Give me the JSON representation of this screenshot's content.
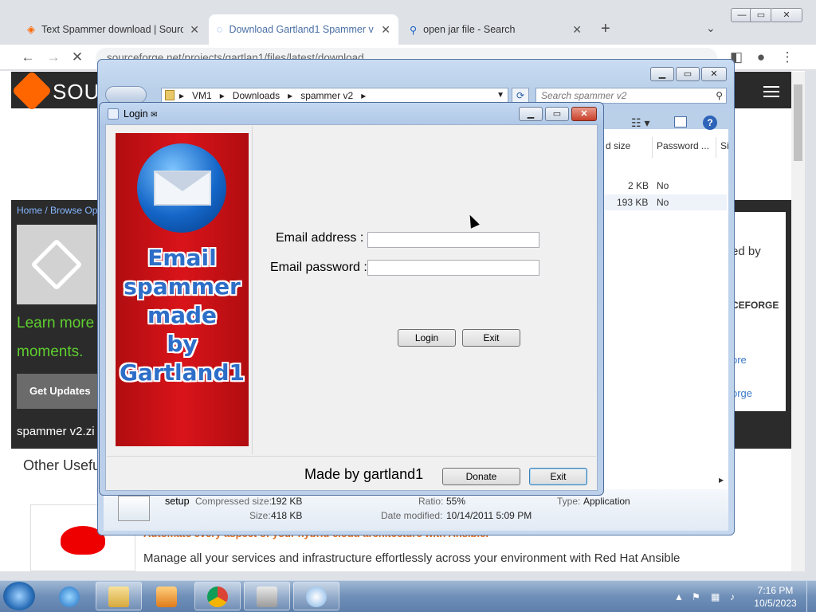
{
  "browser": {
    "tabs": [
      {
        "title": "Text Spammer download | Sourc",
        "active": false
      },
      {
        "title": "Download Gartland1 Spammer v",
        "active": true
      },
      {
        "title": "open jar file - Search",
        "active": false
      }
    ],
    "new_tab": "+",
    "url": "sourceforge.net/projects/gartlan1/files/latest/download"
  },
  "webpage": {
    "logo_text": "SOUR",
    "breadcrumb": "Home / Browse Ope",
    "green_line1": "Learn more",
    "green_line2": "moments.",
    "get_updates": "Get Updates",
    "zip_name": "spammer v2.zi",
    "right_sponsored": "ed by",
    "right_brand": "CEFORGE",
    "right_link1": "ore",
    "right_link2": "orge",
    "other_useful": "Other Usefu",
    "rh_orange": "Automate every aspect of your hybrid cloud architecture with Ansible.",
    "rh_desc": "Manage all your services and infrastructure effortlessly across your environment with Red Hat Ansible"
  },
  "explorer": {
    "path": [
      "VM1",
      "Downloads",
      "spammer v2"
    ],
    "search_placeholder": "Search spammer v2",
    "columns": [
      "d size",
      "Password ...",
      "Si"
    ],
    "rows": [
      {
        "size": "2 KB",
        "password": "No"
      },
      {
        "size": "193 KB",
        "password": "No"
      }
    ],
    "details": {
      "name": "setup",
      "compressed_label": "Compressed size:",
      "compressed": "192 KB",
      "size_label": "Size:",
      "size": "418 KB",
      "ratio_label": "Ratio:",
      "ratio": "55%",
      "date_label": "Date modified:",
      "date": "10/14/2011 5:09 PM",
      "type_label": "Type:",
      "type": "Application"
    }
  },
  "login": {
    "title": "Login",
    "banner_lines": [
      "Email",
      "spammer",
      "made",
      "by",
      "Gartland1"
    ],
    "email_label": "Email address :",
    "password_label": "Email password :",
    "login_btn": "Login",
    "exit_btn": "Exit",
    "made_by": "Made by gartland1",
    "donate_btn": "Donate",
    "exit_btn2": "Exit"
  },
  "taskbar": {
    "time": "7:16 PM",
    "date": "10/5/2023"
  }
}
